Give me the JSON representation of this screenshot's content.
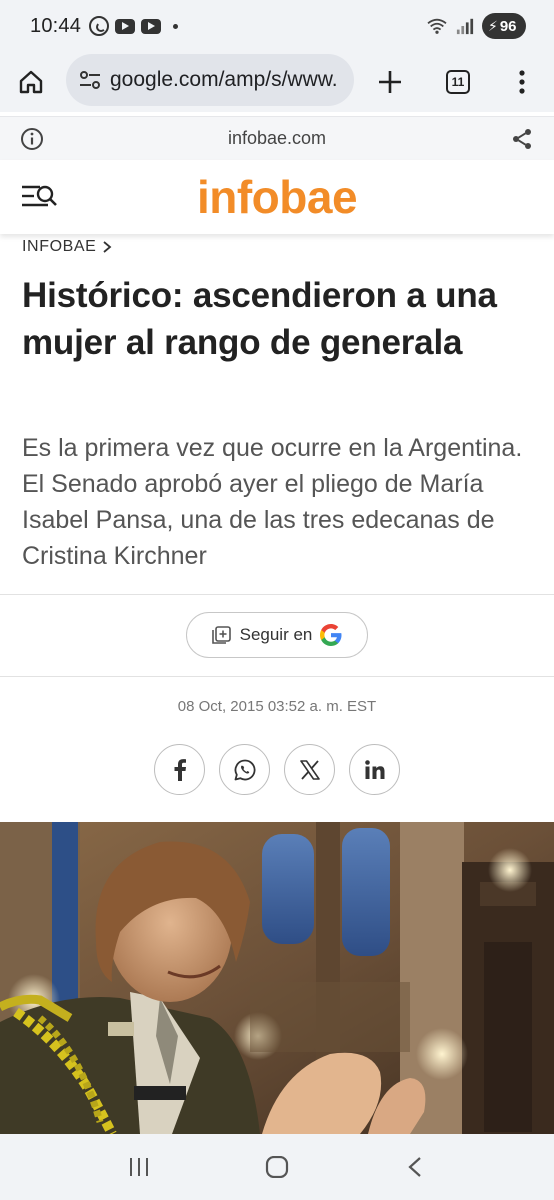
{
  "status_bar": {
    "time": "10:44",
    "battery": "96",
    "left_icons": [
      "whatsapp-icon",
      "youtube-icon",
      "youtube-icon",
      "notification-dot"
    ],
    "right_icons": [
      "wifi-icon",
      "signal-icon",
      "battery-charging-icon"
    ]
  },
  "browser": {
    "url": "google.com/amp/s/www.",
    "tab_count": "11",
    "amp_domain": "infobae.com"
  },
  "site": {
    "logo": "infobae",
    "logo_color": "#f28c28"
  },
  "article": {
    "breadcrumb": "INFOBAE",
    "headline": "Histórico: ascendieron a una mujer al rango de generala",
    "deck": "Es la primera vez que ocurre en la Argentina. El Senado aprobó ayer el pliego de María Isabel Pansa, una de las tres edecanas de Cristina Kirchner",
    "follow_label": "Seguir en",
    "date": "08 Oct, 2015 03:52 a. m. EST",
    "share_icons": [
      "facebook-icon",
      "whatsapp-icon",
      "x-icon",
      "linkedin-icon"
    ]
  }
}
